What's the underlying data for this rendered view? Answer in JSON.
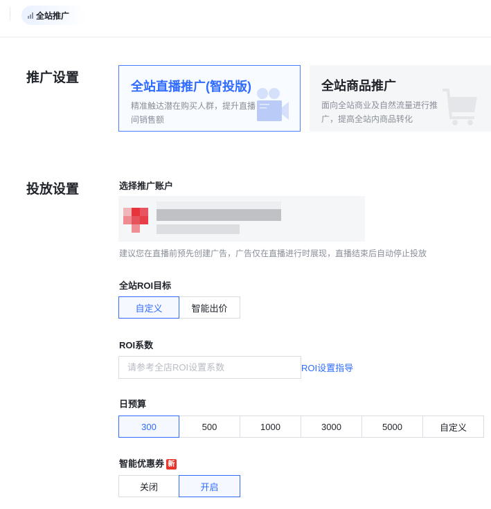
{
  "header": {
    "tab_label": "全站推广"
  },
  "promo_settings": {
    "title": "推广设置",
    "cards": [
      {
        "title": "全站直播推广(智投版)",
        "desc": "精准触达潜在购买人群，提升直播间销售额",
        "selected": true
      },
      {
        "title": "全站商品推广",
        "desc": "面向全站商业及自然流量进行推广，提高全站内商品转化",
        "selected": false
      }
    ]
  },
  "delivery_settings": {
    "title": "投放设置",
    "account": {
      "label": "选择推广账户",
      "hint": "建议您在直播前预先创建广告，广告仅在直播进行时展现，直播结束后自动停止投放"
    },
    "roi_goal": {
      "label": "全站ROI目标",
      "options": [
        "自定义",
        "智能出价"
      ],
      "selected": "自定义"
    },
    "roi_coef": {
      "label": "ROI系数",
      "placeholder": "请参考全店ROI设置系数",
      "value": "",
      "guide_link": "ROI设置指导"
    },
    "budget": {
      "label": "日预算",
      "options": [
        "300",
        "500",
        "1000",
        "3000",
        "5000",
        "自定义"
      ],
      "selected": "300"
    },
    "coupon": {
      "label": "智能优惠券",
      "badge": "新",
      "options": [
        "关闭",
        "开启"
      ],
      "selected": "开启"
    }
  },
  "colors": {
    "accent": "#2f6bff",
    "badge": "#e8352b"
  }
}
